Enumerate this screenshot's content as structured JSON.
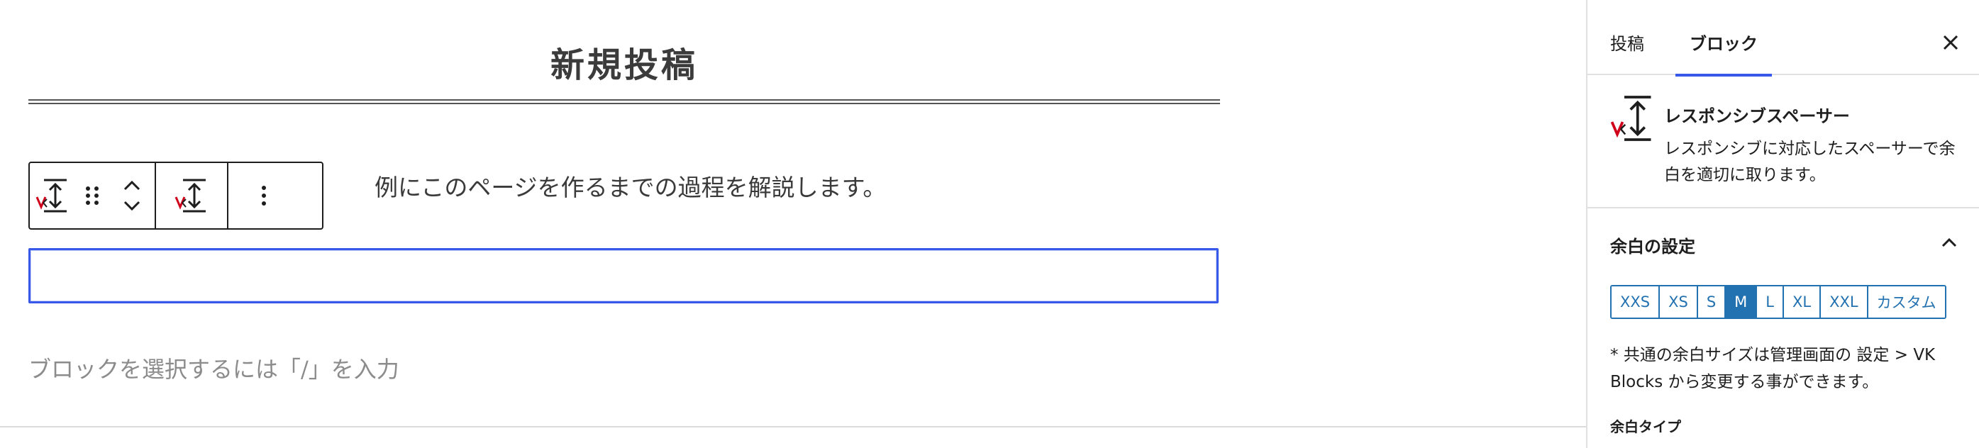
{
  "editor": {
    "page_title": "新規投稿",
    "intro_text": "例にこのページを作るまでの過程を解説します。",
    "appender_placeholder": "ブロックを選択するには「/」を入力",
    "toolbar": {
      "block_icon": "responsive-spacer-icon",
      "drag_icon": "drag-handle-icon",
      "move_icon": "move-up-down-icon",
      "transform_icon": "responsive-spacer-icon",
      "options_icon": "more-vertical-icon"
    }
  },
  "sidebar": {
    "tabs": [
      "投稿",
      "ブロック"
    ],
    "active_tab": "ブロック",
    "close_icon": "close-icon",
    "block": {
      "name": "レスポンシブスペーサー",
      "description": "レスポンシブに対応したスペーサーで余白を適切に取ります。"
    },
    "margin_panel": {
      "title": "余白の設定",
      "toggle_icon": "chevron-up-icon",
      "sizes": [
        "XXS",
        "XS",
        "S",
        "M",
        "L",
        "XL",
        "XXL",
        "カスタム"
      ],
      "selected_size": "M",
      "note": "* 共通の余白サイズは管理画面の 設定 > VK Blocks から変更する事ができます。",
      "spacer_type_label": "余白タイプ"
    }
  },
  "colors": {
    "accent": "#3858e9",
    "button_blue": "#2271b1",
    "vk_logo_red": "#d0021b"
  }
}
